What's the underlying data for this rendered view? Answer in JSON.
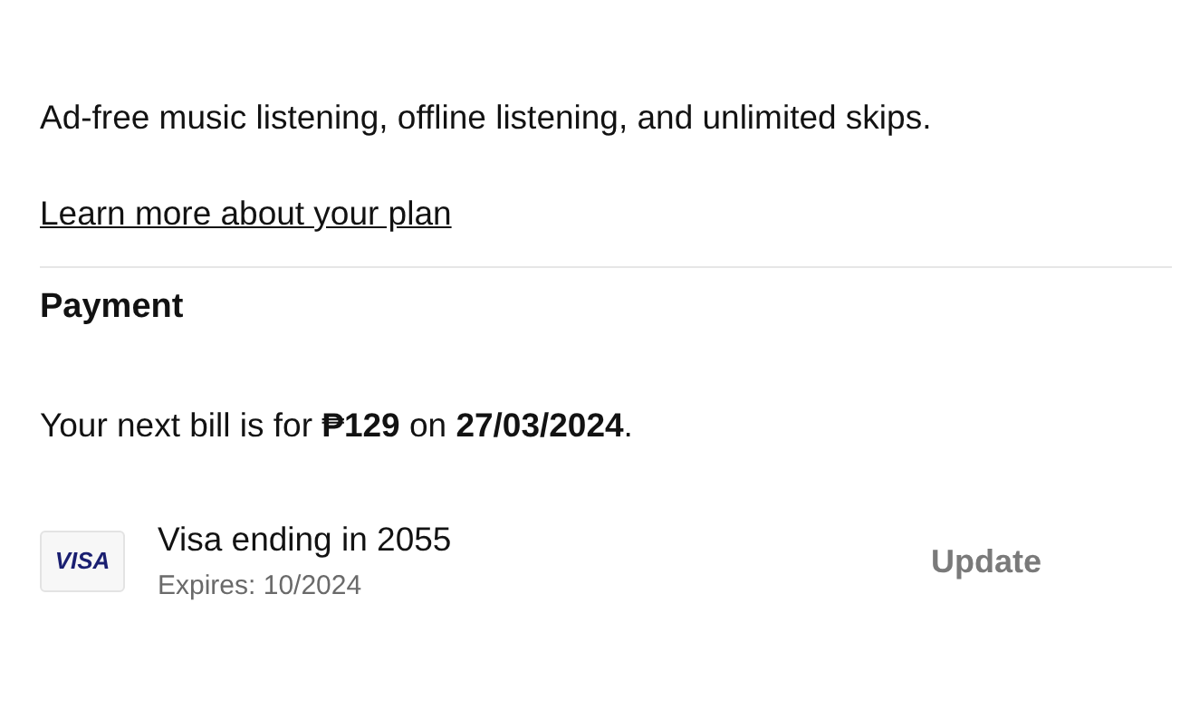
{
  "plan": {
    "description": "Ad-free music listening, offline listening, and unlimited skips.",
    "link": "Learn more about your plan"
  },
  "payment": {
    "heading": "Payment",
    "bill": "Your next bill is for **₱129** on **27/03/2024**.",
    "card": {
      "brand": "VISA",
      "title": "Visa ending in 2055",
      "expires": "Expires: 10/2024",
      "action": "Update"
    }
  }
}
